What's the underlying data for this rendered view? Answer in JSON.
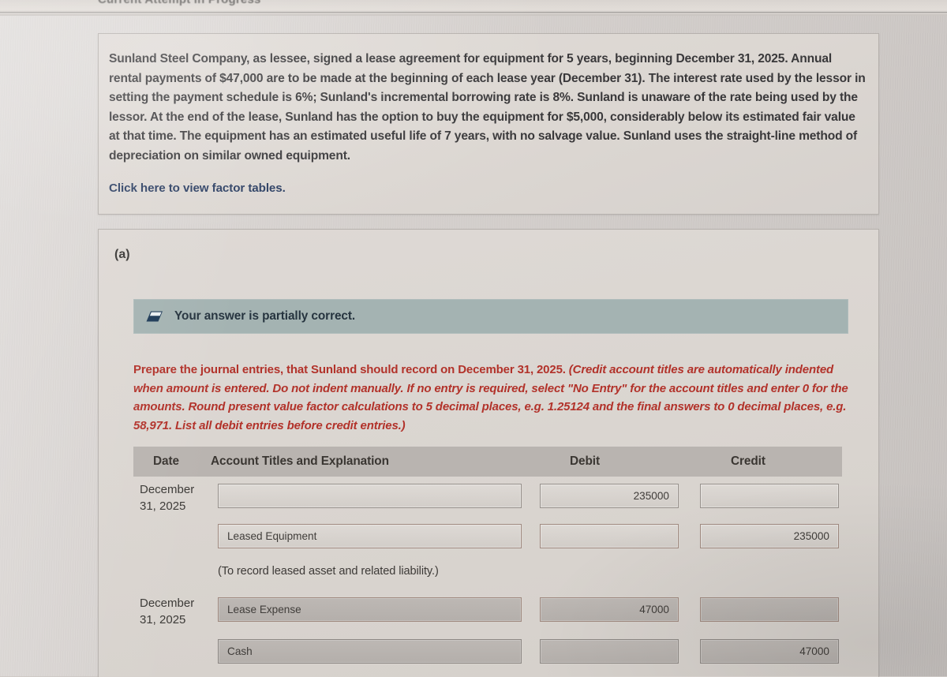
{
  "window": {
    "cropped_header": "Current Attempt in Progress"
  },
  "problem": {
    "text": "Sunland Steel Company, as lessee, signed a lease agreement for equipment for 5 years, beginning December 31, 2025. Annual rental payments of $47,000 are to be made at the beginning of each lease year (December 31). The interest rate used by the lessor in setting the payment schedule is 6%; Sunland's incremental borrowing rate is 8%. Sunland is unaware of the rate being used by the lessor. At the end of the lease, Sunland has the option to buy the equipment for $5,000, considerably below its estimated fair value at that time. The equipment has an estimated useful life of 7 years, with no salvage value. Sunland uses the straight-line method of depreciation on similar owned equipment.",
    "factor_tables_link": "Click here to view factor tables."
  },
  "part": {
    "label": "(a)",
    "alert": {
      "icon": "eraser-icon",
      "message": "Your answer is partially correct.",
      "background_color": "#a4b3b2",
      "text_color": "#26343f"
    },
    "instructions": {
      "lead": "Prepare the journal entries, that Sunland should record on December 31, 2025. ",
      "emphasis": "(Credit account titles are automatically indented when amount is entered. Do not indent manually. If no entry is required, select \"No Entry\" for the account titles and enter 0 for the amounts. Round present value factor calculations to 5 decimal places, e.g. 1.25124 and the final answers to 0 decimal places, e.g. 58,971. List all debit entries before credit entries.)",
      "color": "#b2322a"
    },
    "journal": {
      "headers": {
        "date": "Date",
        "account": "Account Titles and Explanation",
        "debit": "Debit",
        "credit": "Credit"
      },
      "rows": [
        {
          "kind": "entry",
          "date": "December 31, 2025",
          "account": "",
          "account_placeholder": "",
          "debit": "235000",
          "credit": ""
        },
        {
          "kind": "entry",
          "date": "",
          "account": "Leased Equipment",
          "account_placeholder": "",
          "debit": "",
          "credit": "235000"
        },
        {
          "kind": "memo",
          "text": "(To record leased asset and related liability.)"
        },
        {
          "kind": "entry",
          "date": "December 31, 2025",
          "account": "Lease Expense",
          "account_placeholder": "",
          "debit": "47000",
          "credit": ""
        },
        {
          "kind": "entry",
          "date": "",
          "account": "Cash",
          "account_placeholder": "",
          "debit": "",
          "credit": "47000"
        }
      ]
    }
  }
}
